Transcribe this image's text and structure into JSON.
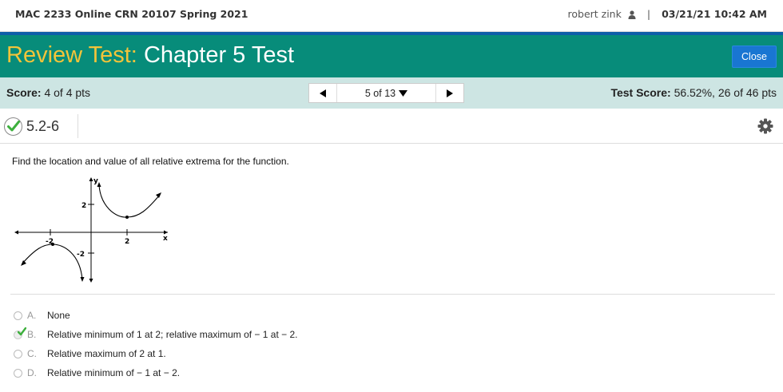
{
  "header": {
    "course": "MAC 2233 Online CRN 20107 Spring 2021",
    "user": "robert zink",
    "separator": "|",
    "datetime": "03/21/21 10:42 AM"
  },
  "title": {
    "label": "Review Test:",
    "name": "Chapter 5 Test",
    "close_label": "Close"
  },
  "scorebar": {
    "score_label": "Score:",
    "score_value": "4 of 4 pts",
    "nav_position": "5 of 13",
    "test_score_label": "Test Score:",
    "test_score_value": "56.52%, 26 of 46 pts"
  },
  "question": {
    "number": "5.2-6",
    "status": "correct",
    "prompt": "Find the location and value of all relative extrema for the function.",
    "graph_labels": {
      "y_axis": "y",
      "x_axis": "x",
      "y_pos": "2",
      "y_neg": "-2",
      "x_pos": "2",
      "x_neg": "-2"
    },
    "options": [
      {
        "letter": "A.",
        "text": "None",
        "selected": false
      },
      {
        "letter": "B.",
        "text": "Relative minimum of 1 at 2; relative maximum of  − 1 at  − 2.",
        "selected": true
      },
      {
        "letter": "C.",
        "text": "Relative maximum of 2 at 1.",
        "selected": false
      },
      {
        "letter": "D.",
        "text": "Relative minimum of  − 1 at  − 2.",
        "selected": false
      }
    ]
  },
  "colors": {
    "titlebar": "#078C7A",
    "accent_bar": "#0E5FA8",
    "title_label": "#F2C43A",
    "scorebar": "#CDE5E3",
    "close_button": "#1976D2",
    "check": "#3DB03D"
  },
  "icons": [
    "person-icon",
    "check-circle-icon",
    "gear-icon",
    "arrow-left-icon",
    "arrow-right-icon",
    "dropdown-icon"
  ]
}
